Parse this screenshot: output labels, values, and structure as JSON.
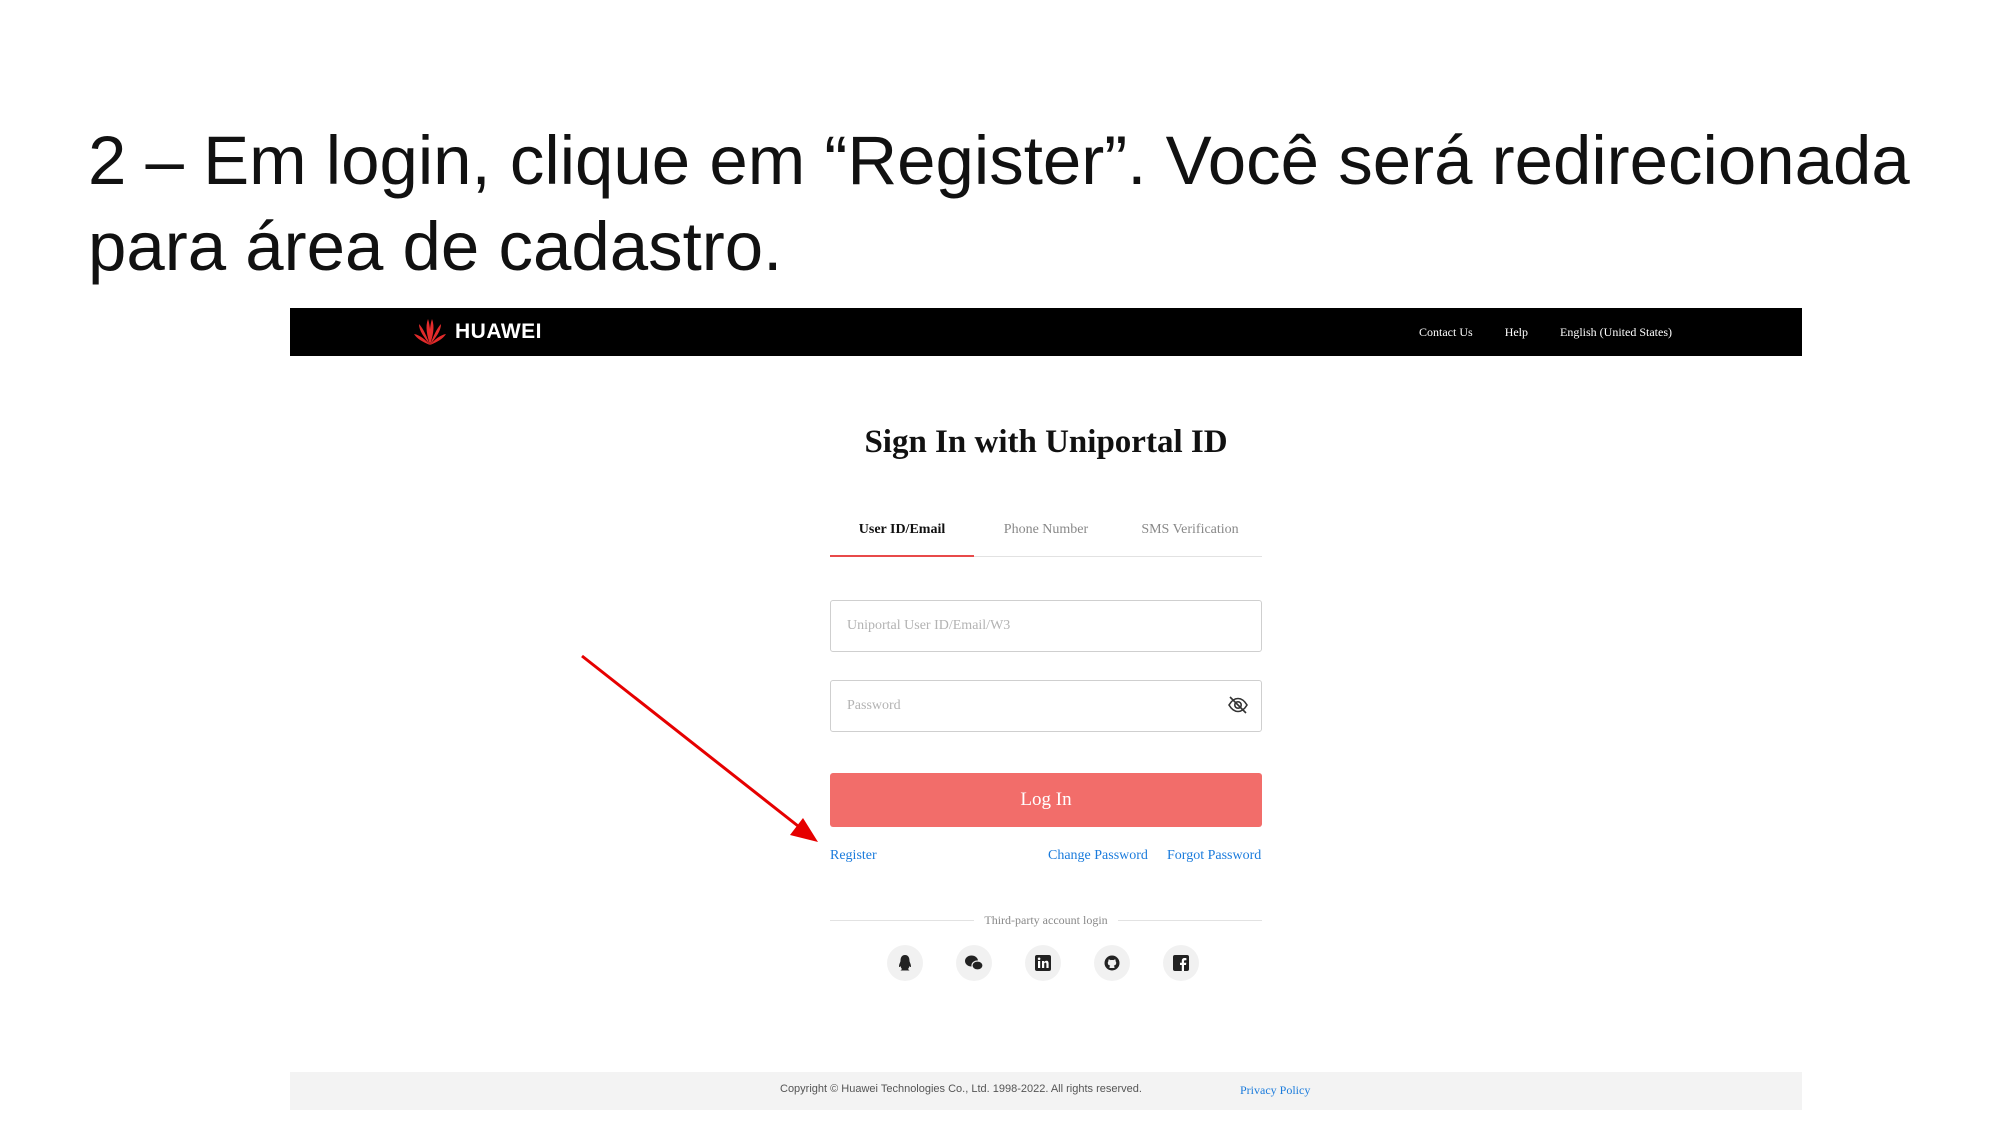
{
  "caption": "2 – Em login, clique em “Register”. Você será redirecionada para área de cadastro.",
  "header": {
    "brand": "HUAWEI",
    "nav": [
      "Contact Us",
      "Help",
      "English (United States)"
    ]
  },
  "login": {
    "title": "Sign In with Uniportal ID",
    "tabs": [
      {
        "label": "User ID/Email",
        "active": true
      },
      {
        "label": "Phone Number",
        "active": false
      },
      {
        "label": "SMS Verification",
        "active": false
      }
    ],
    "user_placeholder": "Uniportal User ID/Email/W3",
    "password_placeholder": "Password",
    "login_label": "Log In",
    "register_label": "Register",
    "change_password_label": "Change Password",
    "forgot_password_label": "Forgot Password",
    "third_party_label": "Third-party account login",
    "social_icons": [
      "qq-icon",
      "wechat-icon",
      "linkedin-icon",
      "github-icon",
      "facebook-icon"
    ]
  },
  "footer": {
    "copyright": "Copyright © Huawei Technologies Co., Ltd. 1998-2022. All rights reserved.",
    "privacy_label": "Privacy Policy"
  },
  "colors": {
    "accent": "#f26d6a",
    "tab_underline": "#e84a4a",
    "link": "#1a7bdc",
    "annotation_arrow": "#e60000",
    "brand_logo": "#e32b2b"
  }
}
